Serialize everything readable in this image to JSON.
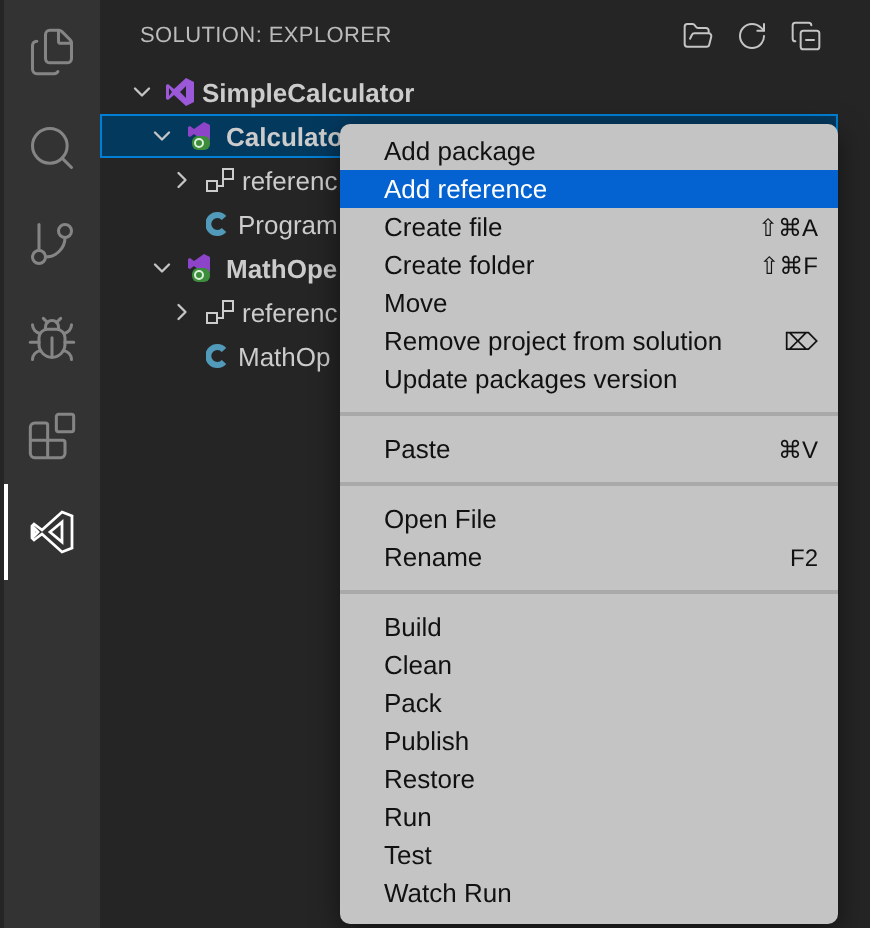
{
  "activity_bar": [
    {
      "kind": "files",
      "selected": false
    },
    {
      "kind": "search",
      "selected": false
    },
    {
      "kind": "scm",
      "selected": false
    },
    {
      "kind": "debug",
      "selected": false
    },
    {
      "kind": "extensions",
      "selected": false
    },
    {
      "kind": "solution",
      "selected": true
    }
  ],
  "sidebar": {
    "title": "SOLUTION: EXPLORER"
  },
  "tree": [
    {
      "label": "SimpleCalculator",
      "kind": "solution",
      "expanded": true,
      "selected": false,
      "children": [
        {
          "label": "Calculato",
          "kind": "project",
          "expanded": true,
          "selected": true,
          "children": [
            {
              "label": "referenc",
              "kind": "references",
              "expanded": false,
              "selected": false
            },
            {
              "label": "Program",
              "kind": "csharp",
              "selected": false
            }
          ]
        },
        {
          "label": "MathOpe",
          "kind": "project",
          "expanded": true,
          "selected": false,
          "children": [
            {
              "label": "referenc",
              "kind": "references",
              "expanded": false,
              "selected": false
            },
            {
              "label": "MathOp",
              "kind": "csharp",
              "selected": false
            }
          ]
        }
      ]
    }
  ],
  "context_menu": [
    [
      {
        "label": "Add package",
        "selected": false
      },
      {
        "label": "Add reference",
        "selected": true
      },
      {
        "label": "Create file",
        "shortcut": "⇧⌘A",
        "selected": false
      },
      {
        "label": "Create folder",
        "shortcut": "⇧⌘F",
        "selected": false
      },
      {
        "label": "Move",
        "selected": false
      },
      {
        "label": "Remove project from solution",
        "shortcut": "⌦",
        "selected": false
      },
      {
        "label": "Update packages version",
        "selected": false
      }
    ],
    [
      {
        "label": "Paste",
        "shortcut": "⌘V",
        "selected": false
      }
    ],
    [
      {
        "label": "Open File",
        "selected": false
      },
      {
        "label": "Rename",
        "shortcut": "F2",
        "selected": false
      }
    ],
    [
      {
        "label": "Build",
        "selected": false
      },
      {
        "label": "Clean",
        "selected": false
      },
      {
        "label": "Pack",
        "selected": false
      },
      {
        "label": "Publish",
        "selected": false
      },
      {
        "label": "Restore",
        "selected": false
      },
      {
        "label": "Run",
        "selected": false
      },
      {
        "label": "Test",
        "selected": false
      },
      {
        "label": "Watch Run",
        "selected": false
      }
    ]
  ]
}
